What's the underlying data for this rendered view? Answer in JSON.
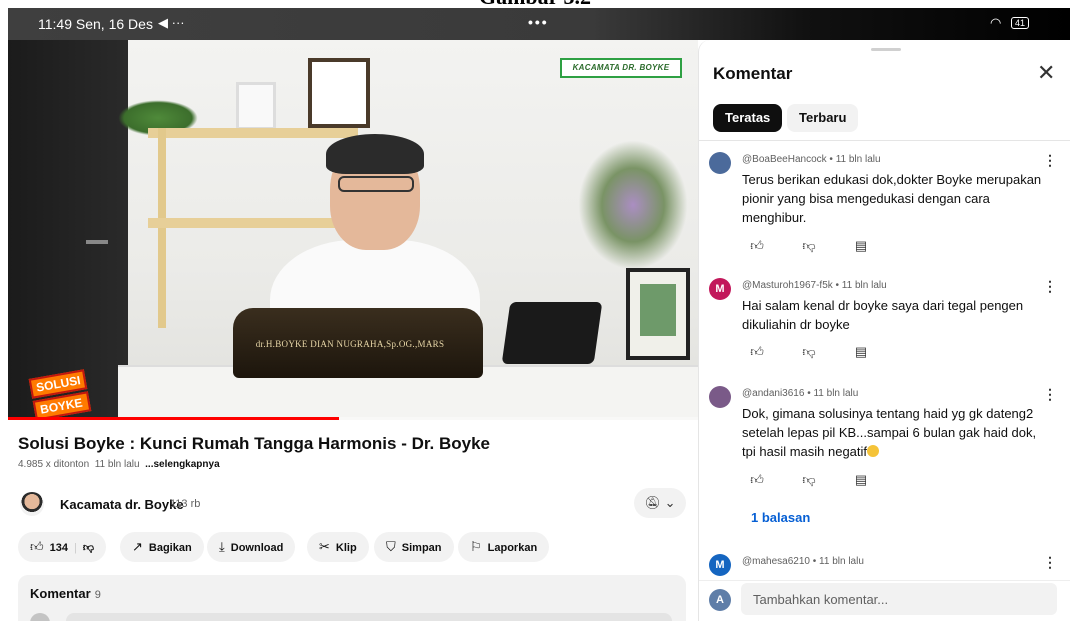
{
  "doc": {
    "title": "Gambar 3.2"
  },
  "status_bar": {
    "time": "11:49",
    "date": "Sen, 16 Des",
    "dots": "•••",
    "battery": "41"
  },
  "video": {
    "channel_badge": "KACAMATA DR. BOYKE",
    "nameplate": "dr.H.BOYKE DIAN NUGRAHA,Sp.OG.,MARS",
    "logo_line1": "SOLUSI",
    "logo_line2": "BOYKE",
    "progress": 0.48,
    "title": "Solusi Boyke : Kunci Rumah Tangga Harmonis - Dr. Boyke",
    "views": "4.985 x ditonton",
    "age": "11 bln lalu",
    "more": "...selengkapnya"
  },
  "channel": {
    "name": "Kacamata dr. Boyke",
    "subscribers": "113 rb"
  },
  "actions": {
    "likes": "134",
    "share": "Bagikan",
    "download": "Download",
    "clip": "Klip",
    "save": "Simpan",
    "report": "Laporkan"
  },
  "comments_card": {
    "label": "Komentar",
    "count": "9"
  },
  "panel": {
    "title": "Komentar",
    "filters": {
      "top": "Teratas",
      "newest": "Terbaru"
    },
    "comments": [
      {
        "meta": "@BoaBeeHancock • 11 bln lalu",
        "text": "Terus berikan edukasi dok,dokter Boyke merupakan pionir yang bisa mengedukasi dengan cara menghibur.",
        "avatar_color": "#4b6a9b",
        "avatar_letter": ""
      },
      {
        "meta": "@Masturoh1967-f5k • 11 bln lalu",
        "text": "Hai salam kenal dr boyke saya dari tegal pengen dikuliahin dr boyke",
        "avatar_color": "#c2185b",
        "avatar_letter": "M"
      },
      {
        "meta": "@andani3616 • 11 bln lalu",
        "text": "Dok, gimana solusinya tentang haid yg gk dateng2 setelah lepas pil KB...sampai 6 bulan gak haid dok, tpi hasil masih negatif",
        "avatar_color": "#7a5a88",
        "avatar_letter": "",
        "replies": "1 balasan"
      },
      {
        "meta": "@mahesa6210 • 11 bln lalu",
        "avatar_color": "#1565c0",
        "avatar_letter": "M"
      }
    ],
    "add_avatar": "A",
    "add_placeholder": "Tambahkan komentar..."
  }
}
